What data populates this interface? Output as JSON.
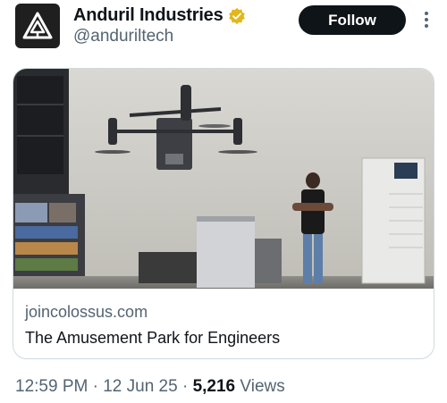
{
  "author": {
    "name": "Anduril Industries",
    "handle": "@anduriltech",
    "avatar_icon": "anduril-logo-icon",
    "verified_badge": "verified-gold-badge-icon",
    "badge_color": "#e2b719"
  },
  "actions": {
    "follow_label": "Follow",
    "more_icon": "more-vertical-icon"
  },
  "card": {
    "domain": "joincolossus.com",
    "title": "The Amusement Park for Engineers",
    "image_description_icon": "drone-photo"
  },
  "meta": {
    "time": "12:59 PM",
    "separator": "·",
    "date": "12 Jun 25",
    "views_count": "5,216",
    "views_label": "Views"
  },
  "colors": {
    "text_primary": "#0f1419",
    "text_secondary": "#536471",
    "follow_bg": "#0f1419",
    "border": "#cfd9de"
  }
}
